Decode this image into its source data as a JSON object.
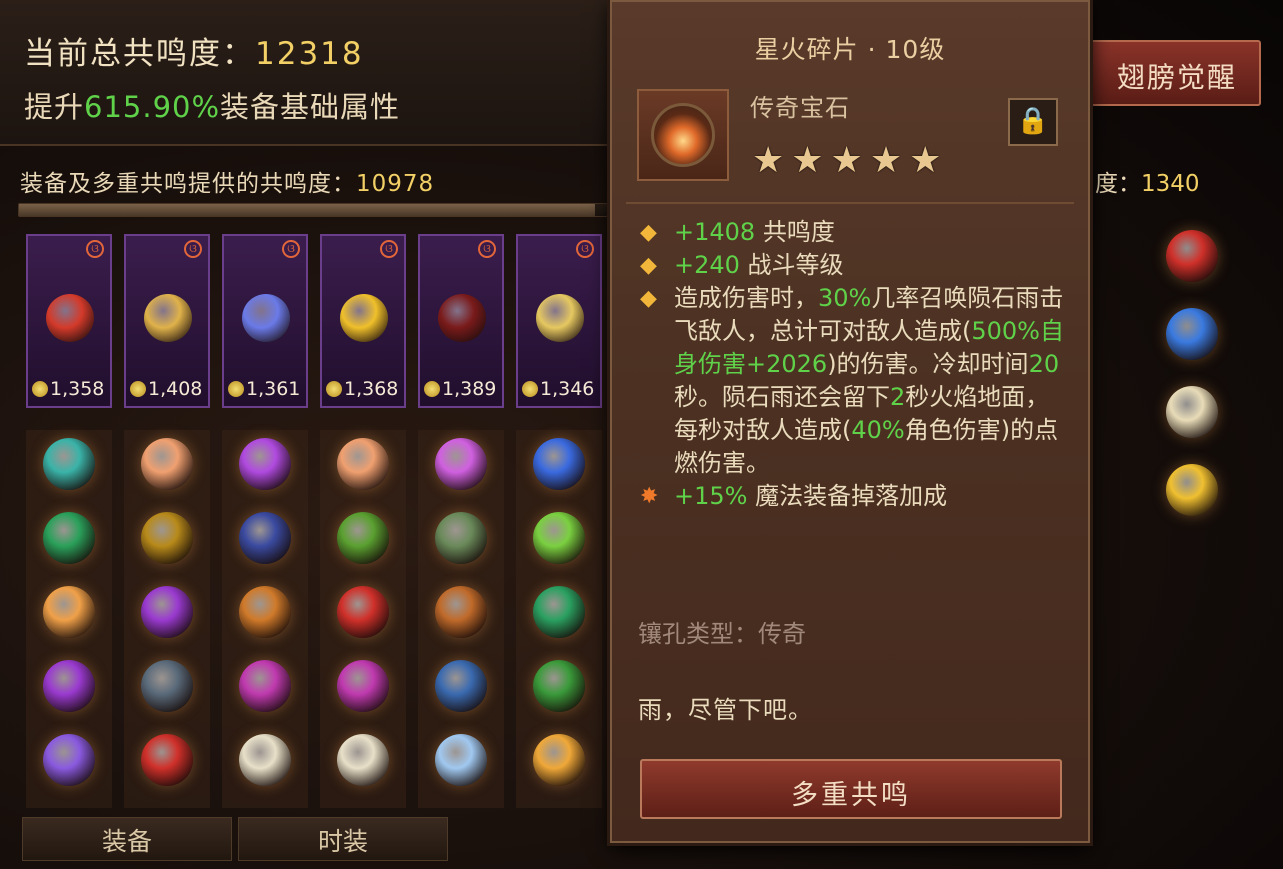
{
  "header": {
    "total_label": "当前总共鸣度：",
    "total_value": "12318",
    "boost_prefix": "提升",
    "boost_value": "615.90%",
    "boost_suffix": "装备基础属性"
  },
  "sub_resonance": {
    "label": "装备及多重共鸣提供的共鸣度：",
    "value": "10978"
  },
  "right_resonance": {
    "label": "度：",
    "value": "1340"
  },
  "wing_button": "翅膀觉醒",
  "equip_cards": [
    {
      "value": "1,358",
      "gem_color": "#d43a2a"
    },
    {
      "value": "1,408",
      "gem_color": "#e0b24a"
    },
    {
      "value": "1,361",
      "gem_color": "#6a7ae8"
    },
    {
      "value": "1,368",
      "gem_color": "#f0c02a"
    },
    {
      "value": "1,389",
      "gem_color": "#7a1a1a"
    },
    {
      "value": "1,346",
      "gem_color": "#e6c860"
    }
  ],
  "gem_grid_colors": [
    [
      "#3ab3a8",
      "#2aa05a",
      "#f0a048",
      "#9a3ad0",
      "#8a5ae0"
    ],
    [
      "#f0a070",
      "#b88a1a",
      "#9a3ad0",
      "#5a6a7a",
      "#d0302a"
    ],
    [
      "#b04ae0",
      "#3a4aa0",
      "#d07a2a",
      "#c03ab0",
      "#e8e0c8"
    ],
    [
      "#f0a070",
      "#5aa030",
      "#d0302a",
      "#c03ab0",
      "#e8e0c8"
    ],
    [
      "#d060e0",
      "#6a8a5a",
      "#c06a2a",
      "#3a6ab0",
      "#a0c8f0"
    ],
    [
      "#3a6ae0",
      "#7ad040",
      "#2aa060",
      "#3a9a3a",
      "#f0a838"
    ]
  ],
  "right_col_colors": [
    "#d0302a",
    "#3a7ae0",
    "#e8dcb8",
    "#f0c030"
  ],
  "tabs": {
    "equip": "装备",
    "fashion": "时装"
  },
  "tooltip": {
    "title": "星火碎片 · 10级",
    "gem_type": "传奇宝石",
    "lock_icon": "🔒",
    "stars": 5,
    "stars_text": "★★★★★",
    "attr1_value": "+1408",
    "attr1_label": " 共鸣度",
    "attr2_value": "+240",
    "attr2_label": " 战斗等级",
    "attr3_a": "造成伤害时，",
    "attr3_b": "30%",
    "attr3_c": "几率召唤陨石雨击飞敌人，总计可对敌人造成(",
    "attr3_d": "500%",
    "attr3_e": "自身伤害",
    "attr3_f": "+2026",
    "attr3_g": ")的伤害。冷却时间",
    "attr3_h": "20",
    "attr3_i": "秒。陨石雨还会留下",
    "attr3_j": "2",
    "attr3_k": "秒火焰地面，每秒对敌人造成(",
    "attr3_l": "40%",
    "attr3_m": "角色伤害)的点燃伤害。",
    "attr4_value": "+15%",
    "attr4_label": " 魔法装备掉落加成",
    "socket": "镶孔类型：传奇",
    "flavor": "雨，尽管下吧。",
    "button": "多重共鸣"
  }
}
